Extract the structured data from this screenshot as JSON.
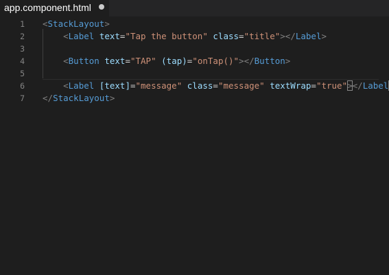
{
  "tab": {
    "title": "app.component.html"
  },
  "editor": {
    "lines": [
      {
        "number": "1",
        "tokens": [
          {
            "t": "<",
            "c": "bracket"
          },
          {
            "t": "StackLayout",
            "c": "tag"
          },
          {
            "t": ">",
            "c": "bracket"
          }
        ]
      },
      {
        "number": "2",
        "tokens": [
          {
            "t": "    ",
            "c": "ws"
          },
          {
            "t": "<",
            "c": "bracket"
          },
          {
            "t": "Label",
            "c": "tag"
          },
          {
            "t": " ",
            "c": "ws"
          },
          {
            "t": "text",
            "c": "attr"
          },
          {
            "t": "=",
            "c": "eq"
          },
          {
            "t": "\"Tap the button\"",
            "c": "str"
          },
          {
            "t": " ",
            "c": "ws"
          },
          {
            "t": "class",
            "c": "attr"
          },
          {
            "t": "=",
            "c": "eq"
          },
          {
            "t": "\"title\"",
            "c": "str"
          },
          {
            "t": "></",
            "c": "bracket"
          },
          {
            "t": "Label",
            "c": "tag"
          },
          {
            "t": ">",
            "c": "bracket"
          }
        ]
      },
      {
        "number": "3",
        "tokens": []
      },
      {
        "number": "4",
        "tokens": [
          {
            "t": "    ",
            "c": "ws"
          },
          {
            "t": "<",
            "c": "bracket"
          },
          {
            "t": "Button",
            "c": "tag"
          },
          {
            "t": " ",
            "c": "ws"
          },
          {
            "t": "text",
            "c": "attr"
          },
          {
            "t": "=",
            "c": "eq"
          },
          {
            "t": "\"TAP\"",
            "c": "str"
          },
          {
            "t": " ",
            "c": "ws"
          },
          {
            "t": "(tap)",
            "c": "attr"
          },
          {
            "t": "=",
            "c": "eq"
          },
          {
            "t": "\"onTap()\"",
            "c": "str"
          },
          {
            "t": "></",
            "c": "bracket"
          },
          {
            "t": "Button",
            "c": "tag"
          },
          {
            "t": ">",
            "c": "bracket"
          }
        ]
      },
      {
        "number": "5",
        "tokens": []
      },
      {
        "number": "6",
        "current": true,
        "tokens": [
          {
            "t": "    ",
            "c": "ws"
          },
          {
            "t": "<",
            "c": "bracket"
          },
          {
            "t": "Label",
            "c": "tag"
          },
          {
            "t": " ",
            "c": "ws"
          },
          {
            "t": "[text]",
            "c": "attr"
          },
          {
            "t": "=",
            "c": "eq"
          },
          {
            "t": "\"message\"",
            "c": "str"
          },
          {
            "t": " ",
            "c": "ws"
          },
          {
            "t": "class",
            "c": "attr"
          },
          {
            "t": "=",
            "c": "eq"
          },
          {
            "t": "\"message\"",
            "c": "str"
          },
          {
            "t": " ",
            "c": "ws"
          },
          {
            "t": "textWrap",
            "c": "attr"
          },
          {
            "t": "=",
            "c": "eq"
          },
          {
            "t": "\"true\"",
            "c": "str"
          },
          {
            "t": ">",
            "c": "bracket-match"
          },
          {
            "t": "</",
            "c": "bracket"
          },
          {
            "t": "Label",
            "c": "tag"
          },
          {
            "t": ">",
            "c": "bracket-match"
          }
        ]
      },
      {
        "number": "7",
        "tokens": [
          {
            "t": "</",
            "c": "bracket"
          },
          {
            "t": "StackLayout",
            "c": "tag"
          },
          {
            "t": ">",
            "c": "bracket"
          }
        ]
      }
    ]
  },
  "colors": {
    "background": "#1e1e1e",
    "tabbar": "#252526",
    "tag": "#569cd6",
    "attribute": "#9cdcfe",
    "string": "#ce9178",
    "bracket": "#808080",
    "line_number": "#858585"
  },
  "icons": {
    "tab_modified": "dot-icon"
  }
}
